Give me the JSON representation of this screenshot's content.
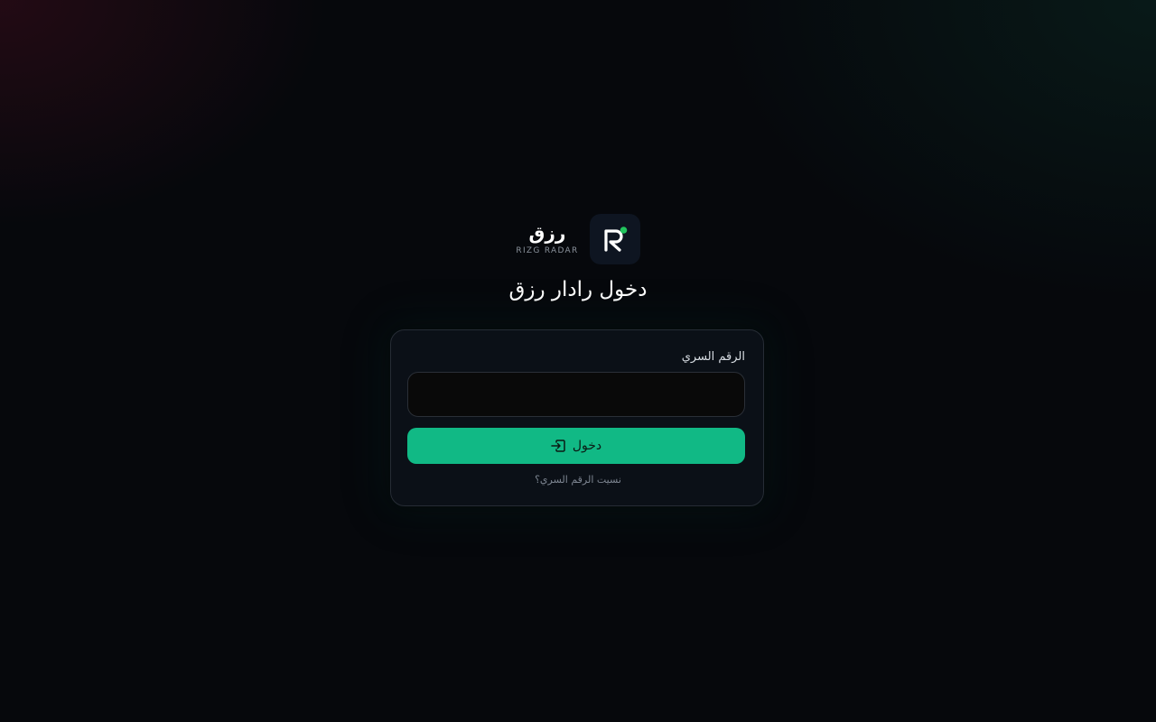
{
  "brand": {
    "name": "رزق",
    "subtitle": "RIZG RADAR",
    "logo_icon": "radar-logo-icon",
    "accent_dot_color": "#22c55e"
  },
  "page": {
    "title": "دخول رادار رزق"
  },
  "login_form": {
    "pin_label": "الرقم السري",
    "pin_value": "",
    "pin_placeholder": "",
    "submit_label": "دخول",
    "submit_icon": "login-arrow-icon",
    "forgot_link": "نسيت الرقم السري؟"
  },
  "colors": {
    "accent": "#11b985",
    "background": "#06080c",
    "card": "#0b1017"
  }
}
